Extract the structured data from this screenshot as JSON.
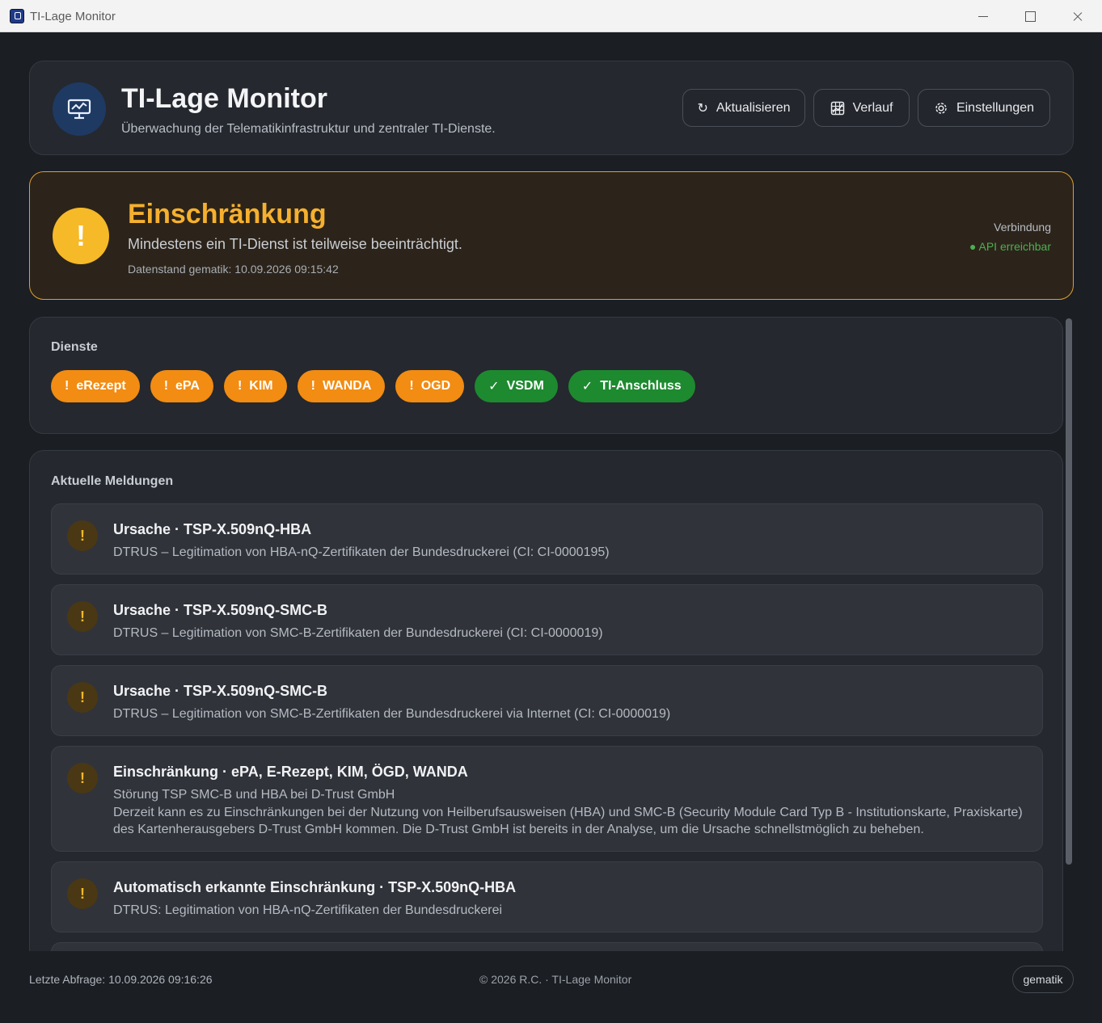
{
  "window": {
    "title": "TI-Lage Monitor"
  },
  "header": {
    "title": "TI-Lage Monitor",
    "subtitle": "Überwachung der Telematikinfrastruktur und zentraler TI-Dienste.",
    "buttons": {
      "refresh": "Aktualisieren",
      "history": "Verlauf",
      "settings": "Einstellungen"
    }
  },
  "status": {
    "icon": "!",
    "title": "Einschränkung",
    "text": "Mindestens ein TI-Dienst ist teilweise beeinträchtigt.",
    "data_date": "Datenstand gematik: 10.09.2026 09:15:42",
    "connection_label": "Verbindung",
    "connection_state": "● API erreichbar",
    "accent_color": "#f5b02e",
    "connection_color": "#4caf50"
  },
  "services": {
    "title": "Dienste",
    "items": [
      {
        "icon": "!",
        "label": "eRezept",
        "state": "warn"
      },
      {
        "icon": "!",
        "label": "ePA",
        "state": "warn"
      },
      {
        "icon": "!",
        "label": "KIM",
        "state": "warn"
      },
      {
        "icon": "!",
        "label": "WANDA",
        "state": "warn"
      },
      {
        "icon": "!",
        "label": "OGD",
        "state": "warn"
      },
      {
        "icon": "✓",
        "label": "VSDM",
        "state": "ok"
      },
      {
        "icon": "✓",
        "label": "TI-Anschluss",
        "state": "ok"
      }
    ],
    "colors": {
      "warn": "#f28c12",
      "ok": "#1d8a2f"
    }
  },
  "messages": {
    "title": "Aktuelle Meldungen",
    "items": [
      {
        "icon": "!",
        "title": "Ursache · TSP-X.509nQ-HBA",
        "lines": [
          "DTRUS – Legitimation von HBA-nQ-Zertifikaten der Bundesdruckerei (CI: CI-0000195)"
        ]
      },
      {
        "icon": "!",
        "title": "Ursache · TSP-X.509nQ-SMC-B",
        "lines": [
          "DTRUS – Legitimation von SMC-B-Zertifikaten der Bundesdruckerei (CI: CI-0000019)"
        ]
      },
      {
        "icon": "!",
        "title": "Ursache · TSP-X.509nQ-SMC-B",
        "lines": [
          "DTRUS – Legitimation von SMC-B-Zertifikaten der Bundesdruckerei via Internet (CI: CI-0000019)"
        ]
      },
      {
        "icon": "!",
        "title": "Einschränkung · ePA, E-Rezept, KIM, ÖGD, WANDA",
        "lines": [
          "Störung TSP SMC-B und HBA bei D-Trust GmbH",
          "Derzeit kann es zu Einschränkungen bei der Nutzung von Heilberufsausweisen (HBA) und SMC-B (Security Module Card Typ B - Institutionskarte, Praxiskarte) des Kartenherausgebers D-Trust GmbH kommen. Die D-Trust GmbH ist bereits in der Analyse, um die Ursache schnellstmöglich zu beheben."
        ]
      },
      {
        "icon": "!",
        "title": "Automatisch erkannte Einschränkung · TSP-X.509nQ-HBA",
        "lines": [
          "DTRUS: Legitimation von HBA-nQ-Zertifikaten der Bundesdruckerei"
        ]
      }
    ]
  },
  "footer": {
    "last_query": "Letzte Abfrage: 10.09.2026 09:16:26",
    "copyright": "© 2026 R.C. · TI-Lage Monitor",
    "badge": "gematik"
  }
}
